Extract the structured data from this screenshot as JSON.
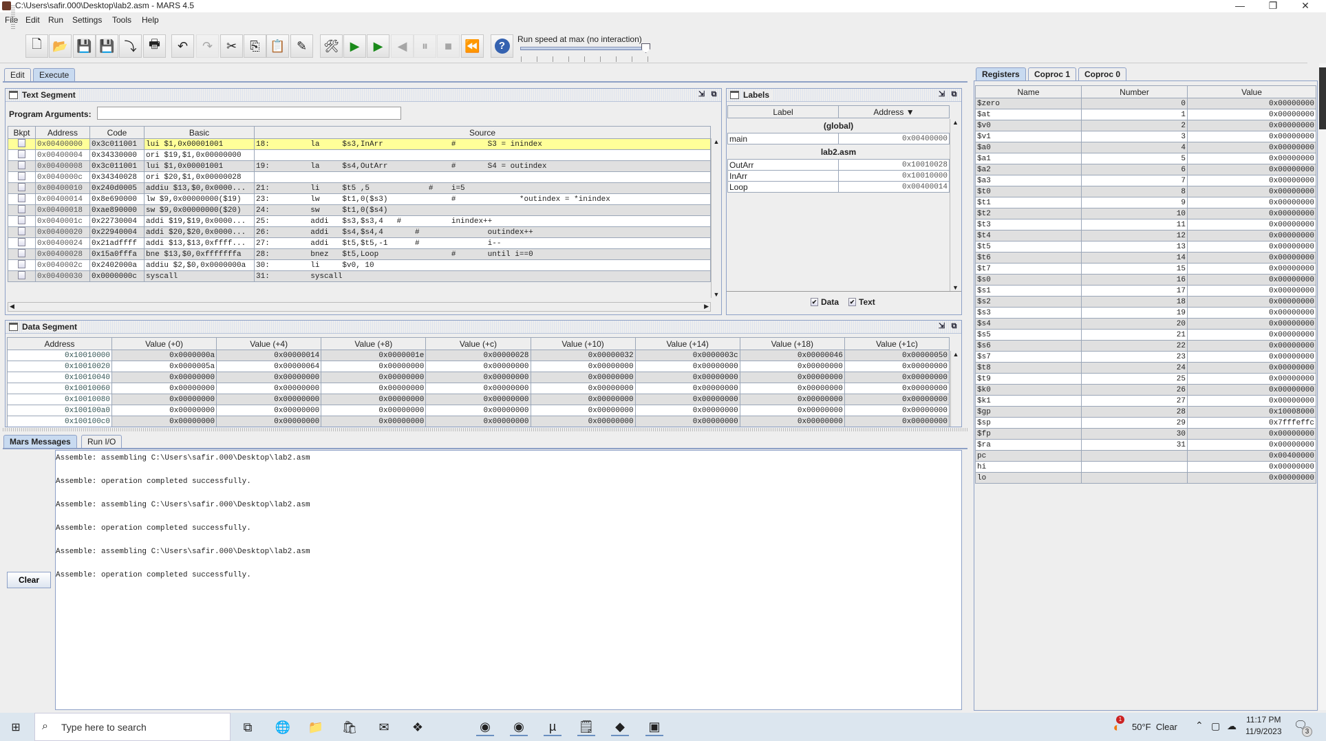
{
  "window": {
    "title": "C:\\Users\\safir.000\\Desktop\\lab2.asm - MARS 4.5",
    "minimize": "—",
    "restore": "❐",
    "close": "✕"
  },
  "menu": [
    "File",
    "Edit",
    "Run",
    "Settings",
    "Tools",
    "Help"
  ],
  "toolbar": {
    "buttons": [
      {
        "name": "new-file",
        "glyph": "🗋",
        "enabled": true
      },
      {
        "name": "open-file",
        "glyph": "📂",
        "enabled": true
      },
      {
        "name": "save-file",
        "glyph": "💾",
        "enabled": true
      },
      {
        "name": "save-as",
        "glyph": "💾",
        "enabled": true
      },
      {
        "name": "dump-memory",
        "glyph": "⤵",
        "enabled": true
      },
      {
        "name": "print",
        "glyph": "🖶",
        "enabled": true
      },
      {
        "name": "undo",
        "glyph": "↶",
        "enabled": true
      },
      {
        "name": "redo",
        "glyph": "↷",
        "enabled": false
      },
      {
        "name": "cut",
        "glyph": "✂",
        "enabled": true
      },
      {
        "name": "copy",
        "glyph": "⎘",
        "enabled": true
      },
      {
        "name": "paste",
        "glyph": "📋",
        "enabled": true
      },
      {
        "name": "find-replace",
        "glyph": "✎",
        "enabled": true
      },
      {
        "name": "assemble",
        "glyph": "🛠",
        "enabled": true
      },
      {
        "name": "run",
        "glyph": "▶",
        "enabled": true
      },
      {
        "name": "step",
        "glyph": "▶",
        "enabled": true
      },
      {
        "name": "backstep",
        "glyph": "◀",
        "enabled": false
      },
      {
        "name": "pause",
        "glyph": "⏸",
        "enabled": false
      },
      {
        "name": "stop",
        "glyph": "■",
        "enabled": false
      },
      {
        "name": "reset",
        "glyph": "⏪",
        "enabled": true
      },
      {
        "name": "help",
        "glyph": "?",
        "enabled": true
      }
    ],
    "speed_label": "Run speed at max (no interaction)",
    "speed_fraction": 1.0
  },
  "tabs": [
    "Edit",
    "Execute"
  ],
  "active_tab": "Execute",
  "text_segment": {
    "title": "Text Segment",
    "program_arguments_label": "Program Arguments:",
    "program_arguments_value": "",
    "columns": [
      "Bkpt",
      "Address",
      "Code",
      "Basic",
      "Source"
    ],
    "rows": [
      {
        "address": "0x00400000",
        "code": "0x3c011001",
        "basic": "lui $1,0x00001001",
        "source": "18:         la     $s3,InArr               #       S3 = inindex"
      },
      {
        "address": "0x00400004",
        "code": "0x34330000",
        "basic": "ori $19,$1,0x00000000",
        "source": ""
      },
      {
        "address": "0x00400008",
        "code": "0x3c011001",
        "basic": "lui $1,0x00001001",
        "source": "19:         la     $s4,OutArr              #       S4 = outindex"
      },
      {
        "address": "0x0040000c",
        "code": "0x34340028",
        "basic": "ori $20,$1,0x00000028",
        "source": ""
      },
      {
        "address": "0x00400010",
        "code": "0x240d0005",
        "basic": "addiu $13,$0,0x0000...",
        "source": "21:         li     $t5 ,5             #    i=5"
      },
      {
        "address": "0x00400014",
        "code": "0x8e690000",
        "basic": "lw $9,0x00000000($19)",
        "source": "23:         lw     $t1,0($s3)              #              *outindex = *inindex"
      },
      {
        "address": "0x00400018",
        "code": "0xae890000",
        "basic": "sw $9,0x00000000($20)",
        "source": "24:         sw     $t1,0($s4)"
      },
      {
        "address": "0x0040001c",
        "code": "0x22730004",
        "basic": "addi $19,$19,0x0000...",
        "source": "25:         addi   $s3,$s3,4   #           inindex++"
      },
      {
        "address": "0x00400020",
        "code": "0x22940004",
        "basic": "addi $20,$20,0x0000...",
        "source": "26:         addi   $s4,$s4,4       #               outindex++"
      },
      {
        "address": "0x00400024",
        "code": "0x21adffff",
        "basic": "addi $13,$13,0xffff...",
        "source": "27:         addi   $t5,$t5,-1      #               i--"
      },
      {
        "address": "0x00400028",
        "code": "0x15a0fffa",
        "basic": "bne $13,$0,0xfffffffa",
        "source": "28:         bnez   $t5,Loop                #       until i==0"
      },
      {
        "address": "0x0040002c",
        "code": "0x2402000a",
        "basic": "addiu $2,$0,0x0000000a",
        "source": "30:         li     $v0, 10"
      },
      {
        "address": "0x00400030",
        "code": "0x0000000c",
        "basic": "syscall",
        "source": "31:         syscall"
      }
    ],
    "highlighted_row": 0
  },
  "labels": {
    "title": "Labels",
    "columns": [
      "Label",
      "Address ▼"
    ],
    "groups": [
      {
        "name": "(global)",
        "items": [
          {
            "label": "main",
            "address": "0x00400000"
          }
        ]
      },
      {
        "name": "lab2.asm",
        "items": [
          {
            "label": "OutArr",
            "address": "0x10010028"
          },
          {
            "label": "InArr",
            "address": "0x10010000"
          },
          {
            "label": "Loop",
            "address": "0x00400014"
          }
        ]
      }
    ],
    "data_checkbox": "Data",
    "data_checked": true,
    "text_checkbox": "Text",
    "text_checked": true
  },
  "data_segment": {
    "title": "Data Segment",
    "columns": [
      "Address",
      "Value (+0)",
      "Value (+4)",
      "Value (+8)",
      "Value (+c)",
      "Value (+10)",
      "Value (+14)",
      "Value (+18)",
      "Value (+1c)"
    ],
    "rows": [
      [
        "0x10010000",
        "0x0000000a",
        "0x00000014",
        "0x0000001e",
        "0x00000028",
        "0x00000032",
        "0x0000003c",
        "0x00000046",
        "0x00000050"
      ],
      [
        "0x10010020",
        "0x0000005a",
        "0x00000064",
        "0x00000000",
        "0x00000000",
        "0x00000000",
        "0x00000000",
        "0x00000000",
        "0x00000000"
      ],
      [
        "0x10010040",
        "0x00000000",
        "0x00000000",
        "0x00000000",
        "0x00000000",
        "0x00000000",
        "0x00000000",
        "0x00000000",
        "0x00000000"
      ],
      [
        "0x10010060",
        "0x00000000",
        "0x00000000",
        "0x00000000",
        "0x00000000",
        "0x00000000",
        "0x00000000",
        "0x00000000",
        "0x00000000"
      ],
      [
        "0x10010080",
        "0x00000000",
        "0x00000000",
        "0x00000000",
        "0x00000000",
        "0x00000000",
        "0x00000000",
        "0x00000000",
        "0x00000000"
      ],
      [
        "0x100100a0",
        "0x00000000",
        "0x00000000",
        "0x00000000",
        "0x00000000",
        "0x00000000",
        "0x00000000",
        "0x00000000",
        "0x00000000"
      ],
      [
        "0x100100c0",
        "0x00000000",
        "0x00000000",
        "0x00000000",
        "0x00000000",
        "0x00000000",
        "0x00000000",
        "0x00000000",
        "0x00000000"
      ]
    ]
  },
  "messages": {
    "tabs": [
      "Mars Messages",
      "Run I/O"
    ],
    "active_tab": "Mars Messages",
    "clear_label": "Clear",
    "lines": [
      "Assemble: assembling C:\\Users\\safir.000\\Desktop\\lab2.asm",
      "Assemble: operation completed successfully.",
      "Assemble: assembling C:\\Users\\safir.000\\Desktop\\lab2.asm",
      "Assemble: operation completed successfully.",
      "Assemble: assembling C:\\Users\\safir.000\\Desktop\\lab2.asm",
      "Assemble: operation completed successfully."
    ]
  },
  "registers": {
    "tabs": [
      "Registers",
      "Coproc 1",
      "Coproc 0"
    ],
    "active_tab": "Registers",
    "columns": [
      "Name",
      "Number",
      "Value"
    ],
    "rows": [
      [
        "$zero",
        "0",
        "0x00000000"
      ],
      [
        "$at",
        "1",
        "0x00000000"
      ],
      [
        "$v0",
        "2",
        "0x00000000"
      ],
      [
        "$v1",
        "3",
        "0x00000000"
      ],
      [
        "$a0",
        "4",
        "0x00000000"
      ],
      [
        "$a1",
        "5",
        "0x00000000"
      ],
      [
        "$a2",
        "6",
        "0x00000000"
      ],
      [
        "$a3",
        "7",
        "0x00000000"
      ],
      [
        "$t0",
        "8",
        "0x00000000"
      ],
      [
        "$t1",
        "9",
        "0x00000000"
      ],
      [
        "$t2",
        "10",
        "0x00000000"
      ],
      [
        "$t3",
        "11",
        "0x00000000"
      ],
      [
        "$t4",
        "12",
        "0x00000000"
      ],
      [
        "$t5",
        "13",
        "0x00000000"
      ],
      [
        "$t6",
        "14",
        "0x00000000"
      ],
      [
        "$t7",
        "15",
        "0x00000000"
      ],
      [
        "$s0",
        "16",
        "0x00000000"
      ],
      [
        "$s1",
        "17",
        "0x00000000"
      ],
      [
        "$s2",
        "18",
        "0x00000000"
      ],
      [
        "$s3",
        "19",
        "0x00000000"
      ],
      [
        "$s4",
        "20",
        "0x00000000"
      ],
      [
        "$s5",
        "21",
        "0x00000000"
      ],
      [
        "$s6",
        "22",
        "0x00000000"
      ],
      [
        "$s7",
        "23",
        "0x00000000"
      ],
      [
        "$t8",
        "24",
        "0x00000000"
      ],
      [
        "$t9",
        "25",
        "0x00000000"
      ],
      [
        "$k0",
        "26",
        "0x00000000"
      ],
      [
        "$k1",
        "27",
        "0x00000000"
      ],
      [
        "$gp",
        "28",
        "0x10008000"
      ],
      [
        "$sp",
        "29",
        "0x7fffeffc"
      ],
      [
        "$fp",
        "30",
        "0x00000000"
      ],
      [
        "$ra",
        "31",
        "0x00000000"
      ],
      [
        "pc",
        "",
        "0x00400000"
      ],
      [
        "hi",
        "",
        "0x00000000"
      ],
      [
        "lo",
        "",
        "0x00000000"
      ]
    ]
  },
  "taskbar": {
    "search_placeholder": "Type here to search",
    "apps": [
      {
        "name": "task-view",
        "glyph": "⧉"
      },
      {
        "name": "edge",
        "glyph": "🌐"
      },
      {
        "name": "file-explorer",
        "glyph": "📁"
      },
      {
        "name": "store",
        "glyph": "🛍"
      },
      {
        "name": "mail",
        "glyph": "✉"
      },
      {
        "name": "app-6",
        "glyph": "❖"
      },
      {
        "name": "chrome-1",
        "glyph": "◉"
      },
      {
        "name": "chrome-2",
        "glyph": "◉"
      },
      {
        "name": "utorrent",
        "glyph": "µ"
      },
      {
        "name": "notepad",
        "glyph": "🗒"
      },
      {
        "name": "app-11",
        "glyph": "◆"
      },
      {
        "name": "mars",
        "glyph": "▣"
      }
    ],
    "weather_badge": "1",
    "weather": "50°F  Clear",
    "time": "11:17 PM",
    "date": "11/9/2023",
    "notifications": "3"
  },
  "colors": {
    "highlight": "#ffff99",
    "selected_tab": "#c8daf0",
    "row_gray": "#e0e0e0",
    "frame": "#8da0c6"
  }
}
